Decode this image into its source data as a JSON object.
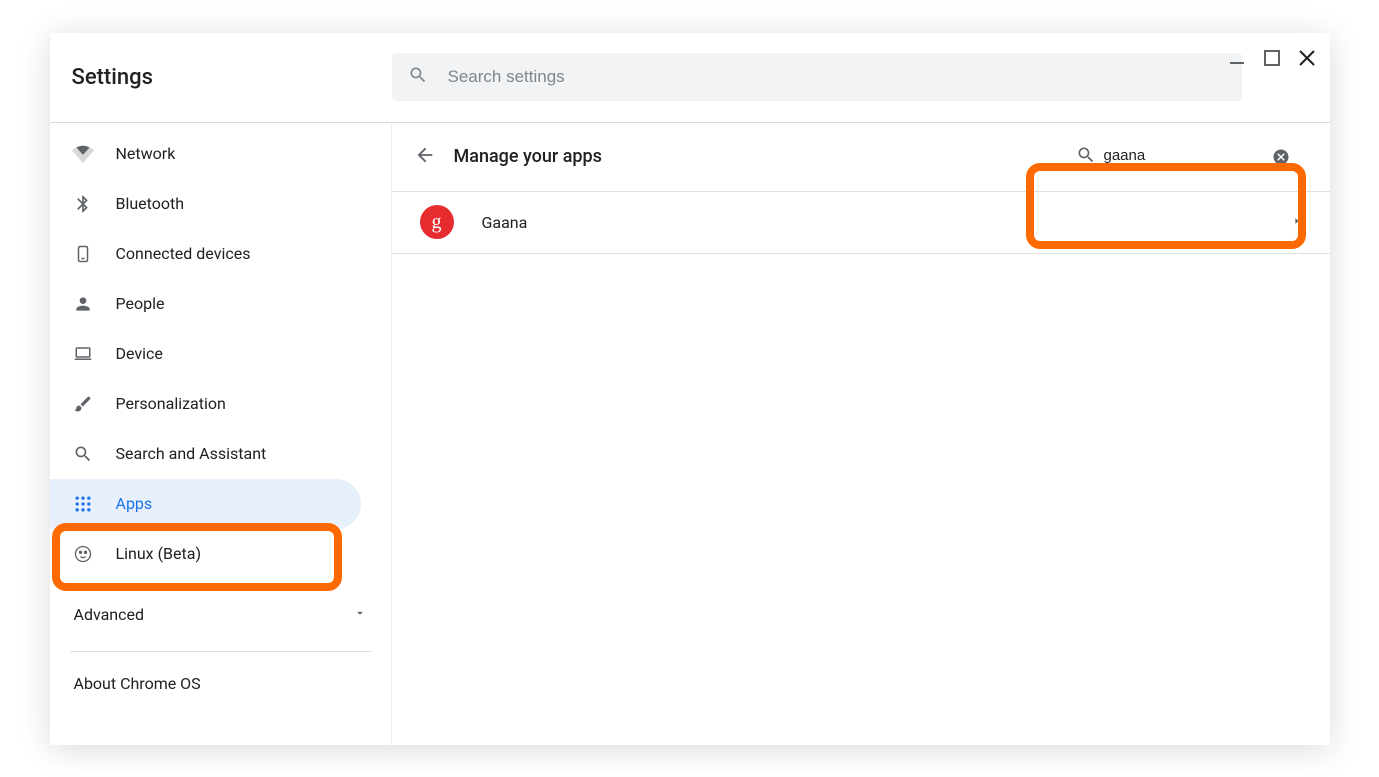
{
  "window": {
    "title": "Settings"
  },
  "search": {
    "placeholder": "Search settings"
  },
  "sidebar": {
    "items": [
      {
        "label": "Network"
      },
      {
        "label": "Bluetooth"
      },
      {
        "label": "Connected devices"
      },
      {
        "label": "People"
      },
      {
        "label": "Device"
      },
      {
        "label": "Personalization"
      },
      {
        "label": "Search and Assistant"
      },
      {
        "label": "Apps"
      },
      {
        "label": "Linux (Beta)"
      }
    ],
    "advanced": "Advanced",
    "about": "About Chrome OS"
  },
  "main": {
    "title": "Manage your apps",
    "search_value": "gaana",
    "apps": [
      {
        "name": "Gaana",
        "badge": "g"
      }
    ]
  },
  "colors": {
    "accent": "#1a73e8",
    "highlight": "#ff6a00",
    "app_icon_bg": "#e72c30"
  }
}
